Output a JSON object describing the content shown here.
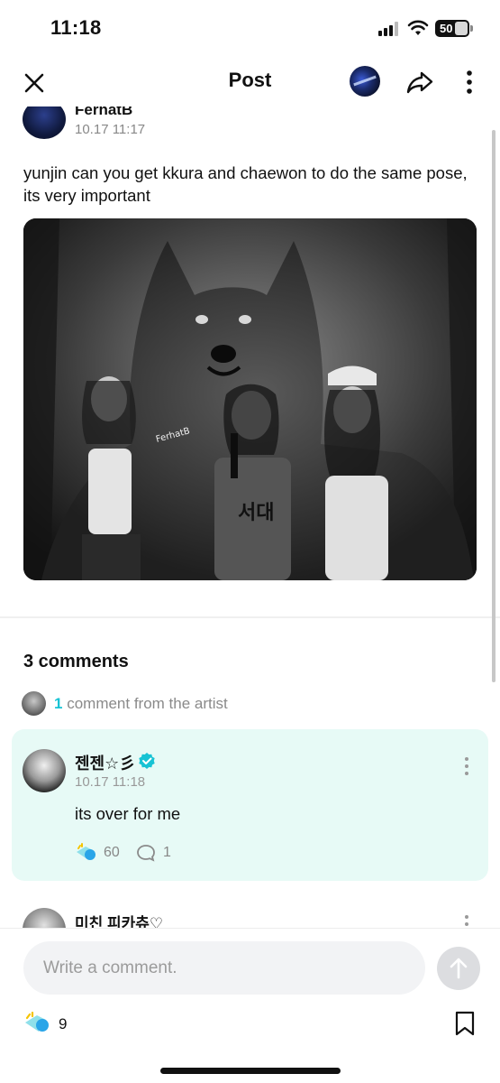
{
  "status_bar": {
    "time": "11:18",
    "battery": "50"
  },
  "header": {
    "title": "Post"
  },
  "post": {
    "author_name": "FerhatB",
    "timestamp": "10.17 11:17",
    "text": "yunjin can you get kkura and chaewon to do the same pose, its very important",
    "image_watermark": "FerhatB",
    "image_jersey_text": "서대"
  },
  "comments": {
    "count_label": "3 comments",
    "artist_count": "1",
    "artist_label": "comment from the artist",
    "items": [
      {
        "name": "젠젠☆彡",
        "time": "10.17 11:18",
        "text": "its over for me",
        "likes": "60",
        "replies": "1"
      },
      {
        "name": "미친 피카츄♡"
      }
    ]
  },
  "composer": {
    "placeholder": "Write a comment."
  },
  "footer": {
    "like_count": "9"
  },
  "colors": {
    "accent": "#18c3d4",
    "artist_card_bg": "#e7faf6"
  }
}
